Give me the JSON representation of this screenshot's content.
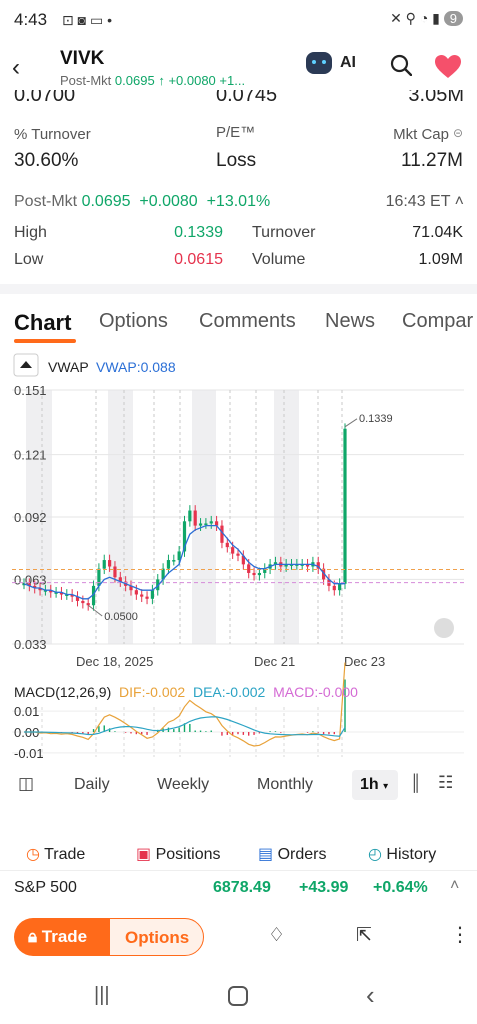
{
  "status": {
    "time": "4:43",
    "battery": "9"
  },
  "header": {
    "ticker": "VIVK",
    "post_label": "Post-Mkt",
    "post_price": "0.0695",
    "post_change": "+0.0080",
    "post_more": "+1...",
    "ai_label": "AI"
  },
  "partial_row": {
    "v1": "0.0700",
    "v2": "0.0745",
    "v3": "3.05M"
  },
  "stats": {
    "turnover_pct_label": "% Turnover",
    "turnover_pct": "30.60%",
    "pe_label": "P/E™",
    "pe": "Loss",
    "mktcap_label": "Mkt Cap",
    "mktcap": "11.27M"
  },
  "postmkt": {
    "label": "Post-Mkt",
    "price": "0.0695",
    "change": "+0.0080",
    "pct": "+13.01%",
    "time": "16:43 ET"
  },
  "hl": {
    "high_label": "High",
    "high": "0.1339",
    "turnover_label": "Turnover",
    "turnover": "71.04K",
    "low_label": "Low",
    "low": "0.0615",
    "volume_label": "Volume",
    "volume": "1.09M"
  },
  "tabs": [
    "Chart",
    "Options",
    "Comments",
    "News",
    "Compar"
  ],
  "chart_data": {
    "type": "candlestick",
    "indicator_label": "VWAP",
    "indicator_value": "VWAP:0.088",
    "y_ticks": [
      "0.151",
      "0.121",
      "0.092",
      "0.063",
      "0.033"
    ],
    "ylim": [
      0.033,
      0.151
    ],
    "x_ticks": [
      "Dec 18, 2025",
      "Dec 21",
      "Dec 23"
    ],
    "annotations": {
      "max": "0.1339",
      "min": "0.0500"
    },
    "close_series": [
      0.061,
      0.06,
      0.059,
      0.058,
      0.058,
      0.057,
      0.057,
      0.056,
      0.056,
      0.055,
      0.053,
      0.052,
      0.051,
      0.06,
      0.068,
      0.072,
      0.069,
      0.064,
      0.062,
      0.06,
      0.058,
      0.056,
      0.055,
      0.054,
      0.058,
      0.063,
      0.068,
      0.072,
      0.072,
      0.076,
      0.09,
      0.095,
      0.088,
      0.089,
      0.089,
      0.09,
      0.088,
      0.08,
      0.078,
      0.075,
      0.074,
      0.07,
      0.066,
      0.065,
      0.066,
      0.068,
      0.07,
      0.071,
      0.069,
      0.07,
      0.07,
      0.07,
      0.07,
      0.069,
      0.071,
      0.068,
      0.063,
      0.06,
      0.058,
      0.061,
      0.133
    ],
    "vwap_series": [
      0.061,
      0.06,
      0.059,
      0.059,
      0.058,
      0.058,
      0.057,
      0.057,
      0.056,
      0.056,
      0.055,
      0.054,
      0.054,
      0.056,
      0.06,
      0.063,
      0.064,
      0.063,
      0.062,
      0.061,
      0.06,
      0.059,
      0.058,
      0.058,
      0.058,
      0.06,
      0.063,
      0.066,
      0.068,
      0.07,
      0.078,
      0.084,
      0.086,
      0.087,
      0.088,
      0.088,
      0.088,
      0.085,
      0.082,
      0.079,
      0.077,
      0.074,
      0.071,
      0.069,
      0.068,
      0.068,
      0.069,
      0.07,
      0.07,
      0.07,
      0.07,
      0.07,
      0.07,
      0.07,
      0.07,
      0.069,
      0.066,
      0.063,
      0.061,
      0.061,
      0.061
    ],
    "ref_lines": {
      "prev_close": 0.0676,
      "avg": 0.0615
    },
    "macd": {
      "label": "MACD(12,26,9)",
      "dif": "DIF:-0.002",
      "dea": "DEA:-0.002",
      "macd": "MACD:-0.000",
      "y_ticks": [
        "0.01",
        "0.00",
        "-0.01"
      ]
    }
  },
  "periods": [
    "Daily",
    "Weekly",
    "Monthly",
    "1h"
  ],
  "bottom_tabs": [
    "Trade",
    "Positions",
    "Orders",
    "History"
  ],
  "index": {
    "name": "S&P 500",
    "value": "6878.49",
    "change": "+43.99",
    "pct": "+0.64%"
  },
  "actions": {
    "trade": "Trade",
    "options": "Options"
  },
  "colors": {
    "up": "#0fa668",
    "down": "#e5334d",
    "accent": "#ff6a1a",
    "vwap": "#2b6fd6"
  }
}
